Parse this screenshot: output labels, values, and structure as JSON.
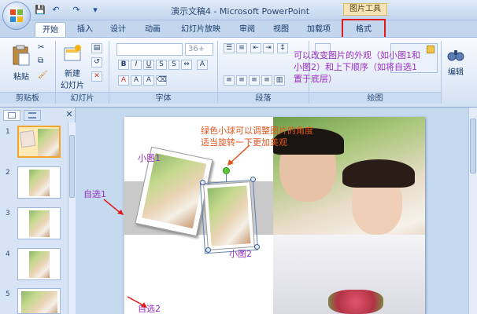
{
  "window": {
    "title": "演示文稿4 - Microsoft PowerPoint",
    "context_tab_group": "图片工具"
  },
  "quick_access": [
    "save-icon",
    "undo-icon",
    "redo-icon",
    "customize-icon"
  ],
  "tabs": [
    {
      "label": "开始",
      "active": true
    },
    {
      "label": "插入",
      "active": false
    },
    {
      "label": "设计",
      "active": false
    },
    {
      "label": "动画",
      "active": false
    },
    {
      "label": "幻灯片放映",
      "active": false
    },
    {
      "label": "审阅",
      "active": false
    },
    {
      "label": "视图",
      "active": false
    },
    {
      "label": "加载项",
      "active": false
    },
    {
      "label": "格式",
      "active": false
    }
  ],
  "ribbon": {
    "paste_label": "粘贴",
    "new_slide_label": "新建",
    "new_slide_label2": "幻灯片",
    "font_size_value": "36+",
    "edit_label": "编辑",
    "groups": [
      "剪贴板",
      "幻灯片",
      "字体",
      "段落",
      "绘图"
    ]
  },
  "annotations": {
    "top_right_line1": "可以改变图片的外观（如小图1和",
    "top_right_line2": "小图2）和上下顺序（如将自选1",
    "top_right_line3": "置于底层）",
    "rotate_line1": "绿色小球可以调整图片的角度",
    "rotate_line2": "适当旋转一下更加美观",
    "small_pic1": "小图1",
    "small_pic2": "小图2",
    "auto1": "自选1",
    "auto2": "自选2"
  },
  "slides": [
    {
      "number": "1",
      "selected": true
    },
    {
      "number": "2",
      "selected": false
    },
    {
      "number": "3",
      "selected": false
    },
    {
      "number": "4",
      "selected": false
    },
    {
      "number": "5",
      "selected": false
    }
  ],
  "colors": {
    "annotation_purple": "#9b2fc4",
    "annotation_orange": "#e0541d",
    "highlight_red": "#e01b1b",
    "ribbon_blue": "#dfe9f7"
  }
}
